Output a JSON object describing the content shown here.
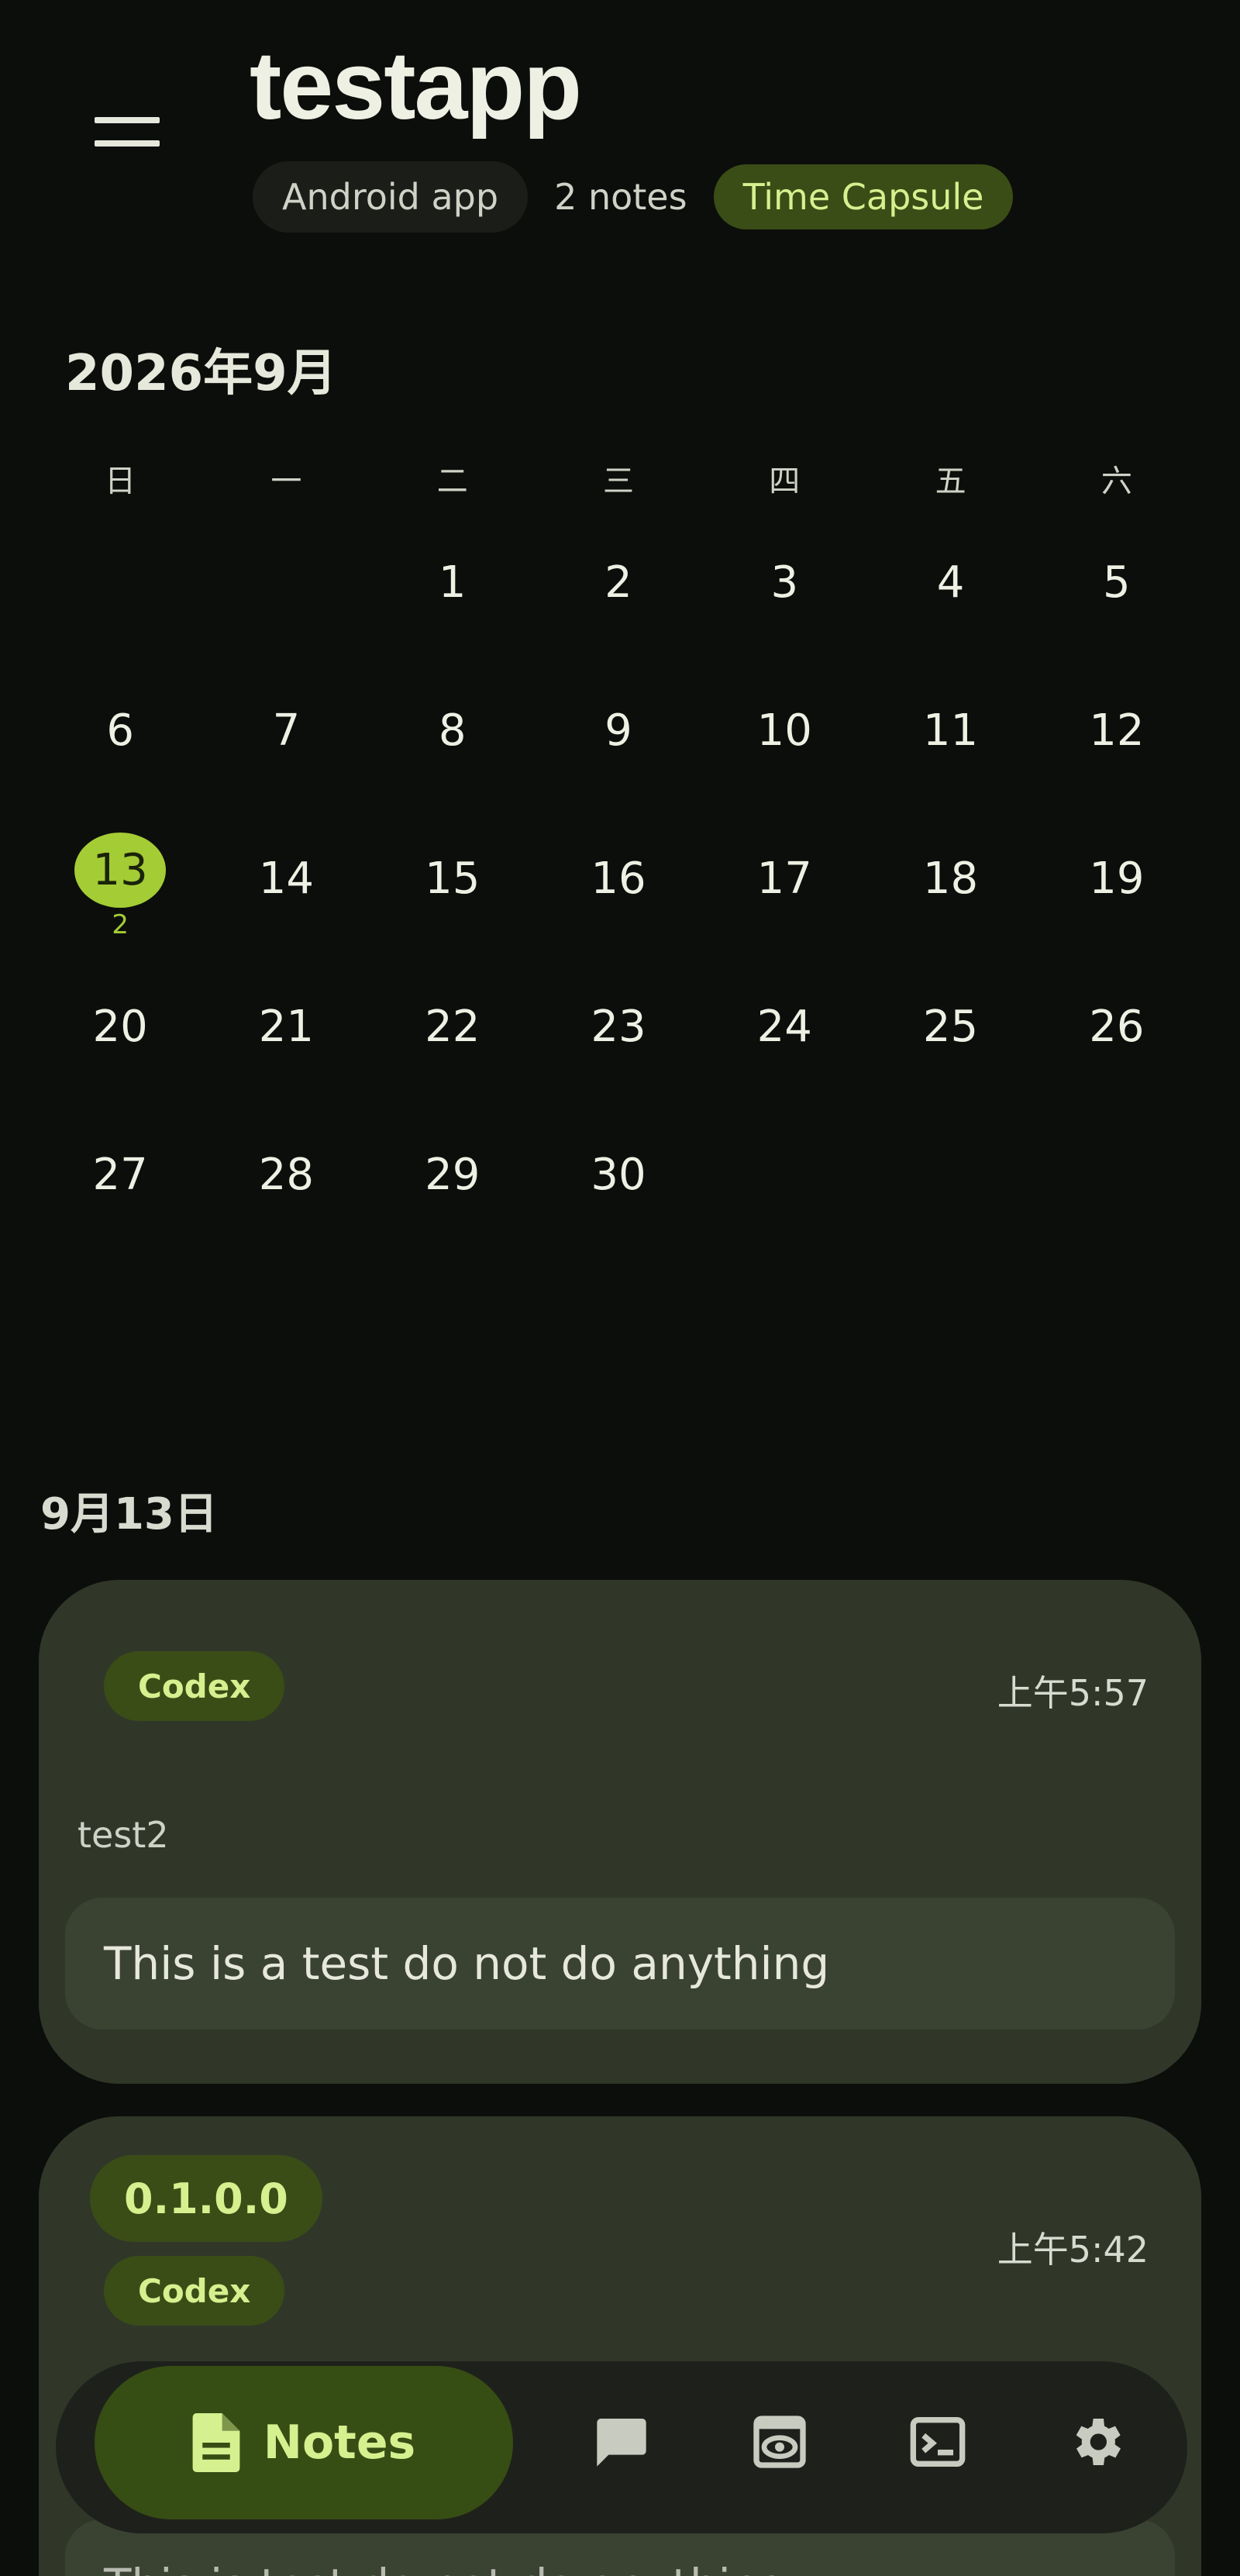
{
  "header": {
    "title": "testapp",
    "chips": [
      "Android app",
      "2 notes",
      "Time Capsule"
    ]
  },
  "calendar": {
    "month_title": "2026年9月",
    "weekdays": [
      "日",
      "一",
      "二",
      "三",
      "四",
      "五",
      "六"
    ],
    "days": [
      "",
      "",
      "1",
      "2",
      "3",
      "4",
      "5",
      "6",
      "7",
      "8",
      "9",
      "10",
      "11",
      "12",
      "13",
      "14",
      "15",
      "16",
      "17",
      "18",
      "19",
      "20",
      "21",
      "22",
      "23",
      "24",
      "25",
      "26",
      "27",
      "28",
      "29",
      "30",
      "",
      "",
      ""
    ],
    "selected_day": "13",
    "selected_count": "2"
  },
  "day_section": {
    "title": "9月13日",
    "notes": [
      {
        "tags": [
          "Codex"
        ],
        "time": "上午5:57",
        "title": "test2",
        "body": "This is a test do not do anything"
      },
      {
        "tags": [
          "0.1.0.0",
          "Codex"
        ],
        "time": "上午5:42",
        "title": "",
        "body": "This is test do not do anything"
      }
    ]
  },
  "bottom_nav": {
    "active_label": "Notes",
    "items": [
      "notes-icon",
      "chat-icon",
      "preview-icon",
      "terminal-icon",
      "settings-icon"
    ]
  },
  "colors": {
    "background": "#0c0e0b",
    "accent": "#a4cc35",
    "card": "#303729",
    "tag_bg": "#3a4d16",
    "tag_text": "#d5f08f"
  }
}
